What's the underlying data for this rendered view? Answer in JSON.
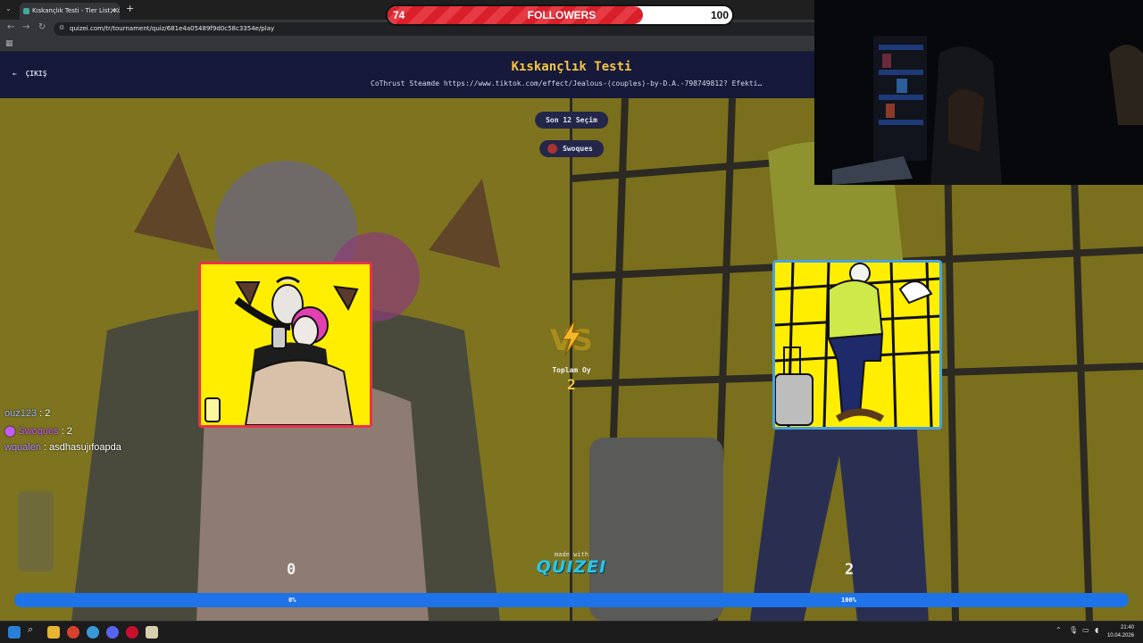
{
  "browser": {
    "tab_title": "Kıskançlık Testi - Tier List, Kör S",
    "url": "quizei.com/tr/tournament/quiz/681e4a05489f9d0c58c3354e/play"
  },
  "quiz": {
    "exit_label": "ÇIKIŞ",
    "title": "Kıskançlık Testi",
    "subtitle": "CoThrust Steamde https://www.tiktok.com/effect/Jealous-(couples)-by-D.A.-798749812? Efekti…",
    "round_label": "Son 12 Seçim",
    "user_label": "Swoques",
    "total_label": "Toplam Oy",
    "total_value": "2",
    "left_score": "0",
    "right_score": "2",
    "left_percent": "0%",
    "right_percent": "100%",
    "right_share": 1.0,
    "made_with": "made with",
    "brand": "QUIZEI"
  },
  "chat": {
    "lines": [
      {
        "user": "ouz123",
        "message": " : 2"
      },
      {
        "user": "Swoques",
        "message": " : 2"
      },
      {
        "user": "wqualen",
        "message": " : asdhasujıfoapda"
      }
    ]
  },
  "followers": {
    "current": "74",
    "label": "FOLLOWERS",
    "goal": "100",
    "progress": 0.74
  },
  "taskbar": {
    "time": "21:40",
    "date": "10.04.2026"
  },
  "colors": {
    "accent_yellow": "#f5c542",
    "left_border": "#e8334a",
    "right_border": "#4a9fe0",
    "progress_blue": "#1e73e8"
  }
}
